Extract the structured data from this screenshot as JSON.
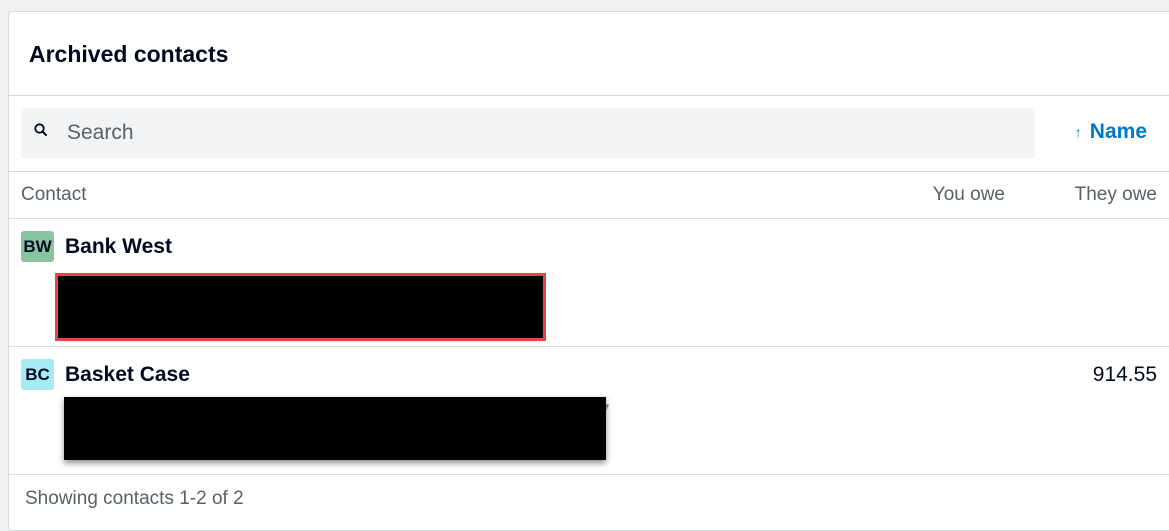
{
  "header": {
    "title": "Archived contacts"
  },
  "toolbar": {
    "search_placeholder": "Search",
    "search_value": "",
    "sort_label": "Name",
    "sort_arrow": "↑",
    "search_icon": "search-icon"
  },
  "columns": {
    "contact": "Contact",
    "you_owe": "You owe",
    "they_owe": "They owe"
  },
  "contacts": [
    {
      "initials": "BW",
      "name": "Bank West",
      "avatar_color": "#87c5a0",
      "you_owe": "",
      "they_owe": "",
      "detail_redacted": true
    },
    {
      "initials": "BC",
      "name": "Basket Case",
      "avatar_color": "#a4ebf3",
      "you_owe": "",
      "they_owe": "914.55",
      "detail_redacted": true,
      "visible_trailing_char": "7"
    }
  ],
  "footer": {
    "status": "Showing contacts 1-2 of 2"
  },
  "colors": {
    "accent": "#0078c8",
    "text": "#000a1e",
    "muted": "#59606a",
    "border": "#d6dade",
    "redaction_outline": "#e04848"
  }
}
